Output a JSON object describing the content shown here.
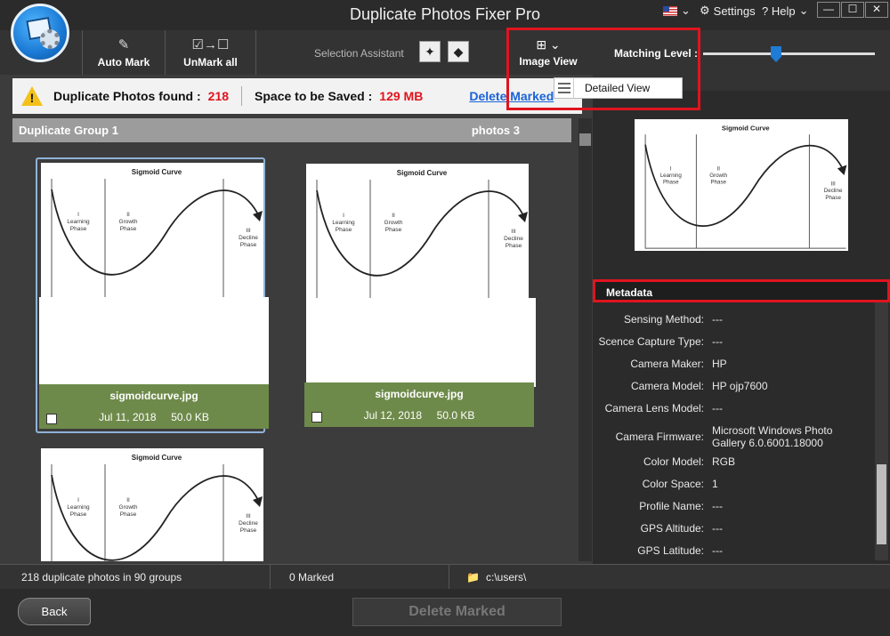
{
  "app": {
    "title": "Duplicate Photos Fixer Pro",
    "settings": "Settings",
    "help": "? Help"
  },
  "toolbar": {
    "auto_mark": "Auto Mark",
    "unmark_all": "UnMark all",
    "selection_assistant": "Selection Assistant",
    "image_view": "Image View",
    "matching_level": "Matching Level :",
    "matching_level_value": 0.42
  },
  "dropdown": {
    "item": "Detailed View"
  },
  "info": {
    "dup_found_label": "Duplicate Photos found :",
    "dup_found_value": "218",
    "space_label": "Space to be Saved :",
    "space_value": "129 MB",
    "delete_link": "Delete Marked"
  },
  "group": {
    "title": "Duplicate Group 1",
    "count": "photos 3"
  },
  "photos": [
    {
      "file": "sigmoidcurve.jpg",
      "date": "Jul 11, 2018",
      "size": "50.0 KB"
    },
    {
      "file": "sigmoidcurve.jpg",
      "date": "Jul 12, 2018",
      "size": "50.0 KB"
    },
    {
      "file": "",
      "date": "",
      "size": ""
    }
  ],
  "thumb": {
    "title": "Sigmoid Curve",
    "p1": "I\nLearning\nPhase",
    "p2": "II\nGrowth\nPhase",
    "p3": "III\nDecline\nPhase"
  },
  "metadata": {
    "heading": "Metadata",
    "rows": [
      {
        "k": "Sensing Method:",
        "v": "---"
      },
      {
        "k": "Scence Capture Type:",
        "v": "---"
      },
      {
        "k": "Camera Maker:",
        "v": "HP"
      },
      {
        "k": "Camera Model:",
        "v": "HP ojp7600"
      },
      {
        "k": "Camera Lens Model:",
        "v": "---"
      },
      {
        "k": "Camera Firmware:",
        "v": "Microsoft Windows Photo Gallery 6.0.6001.18000"
      },
      {
        "k": "Color Model:",
        "v": "RGB"
      },
      {
        "k": "Color Space:",
        "v": "1"
      },
      {
        "k": "Profile Name:",
        "v": "---"
      },
      {
        "k": "GPS Altitude:",
        "v": "---"
      },
      {
        "k": "GPS Latitude:",
        "v": "---"
      }
    ]
  },
  "status": {
    "summary": "218 duplicate photos in 90 groups",
    "marked": "0 Marked",
    "path": "c:\\users\\"
  },
  "buttons": {
    "back": "Back",
    "delete": "Delete Marked"
  }
}
